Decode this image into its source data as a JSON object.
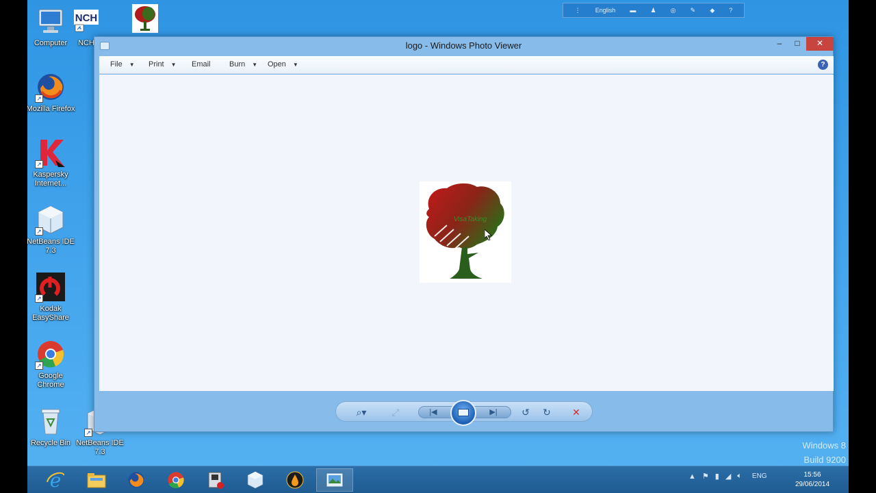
{
  "desktop": {
    "icons": [
      {
        "label": "Computer",
        "icon": "computer-icon"
      },
      {
        "label": "NCH",
        "icon": "nch-software-icon"
      },
      {
        "label": "",
        "icon": "tree-logo-icon"
      },
      {
        "label": "Mozilla Firefox",
        "icon": "firefox-icon"
      },
      {
        "label": "Kaspersky Internet...",
        "icon": "kaspersky-icon"
      },
      {
        "label": "NetBeans IDE 7.3",
        "icon": "netbeans-icon"
      },
      {
        "label": "Kodak EasyShare",
        "icon": "app-red-icon"
      },
      {
        "label": "Google Chrome",
        "icon": "chrome-icon"
      },
      {
        "label": "Recycle Bin",
        "icon": "recycle-bin-icon"
      },
      {
        "label": "NetBeans IDE 7.3",
        "icon": "netbeans-icon"
      }
    ],
    "watermark": {
      "line1": "Windows 8",
      "line2": "Build 9200"
    }
  },
  "ime": {
    "language": "English"
  },
  "window": {
    "title": "logo - Windows Photo Viewer",
    "menus": [
      {
        "label": "File"
      },
      {
        "label": "Print"
      },
      {
        "label": "Email"
      },
      {
        "label": "Burn"
      },
      {
        "label": "Open"
      }
    ],
    "help": "?",
    "image_text": "VisaTaking"
  },
  "controls": {
    "zoom": "zoom-icon",
    "actual_size": "actual-size-icon",
    "previous": "previous-icon",
    "slideshow": "slideshow-icon",
    "next": "next-icon",
    "rotate_ccw": "rotate-counterclockwise-icon",
    "rotate_cw": "rotate-clockwise-icon",
    "delete": "delete-icon"
  },
  "taskbar": {
    "apps": [
      "internet-explorer-icon",
      "file-explorer-icon",
      "firefox-icon",
      "chrome-icon",
      "app-icon",
      "netbeans-icon",
      "oil-drop-icon",
      "photo-viewer-icon"
    ],
    "language": "ENG",
    "time": "15:56",
    "date": "29/06/2014"
  },
  "colors": {
    "desktop": "#3a9ce8",
    "close_button": "#c7443f",
    "taskbar": "#245f96"
  }
}
